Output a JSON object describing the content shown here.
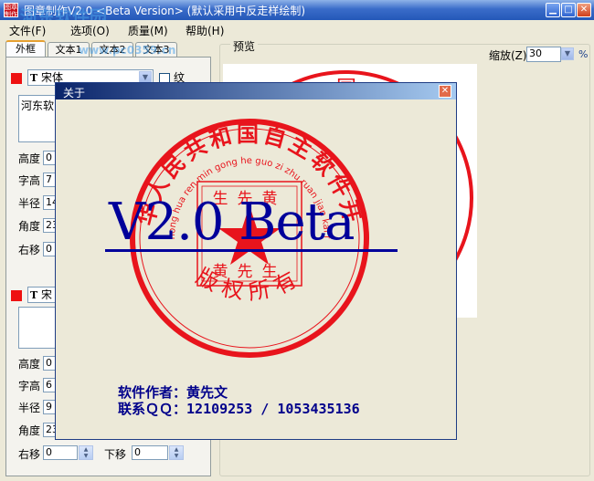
{
  "window": {
    "title": "图章制作V2.0 <Beta Version> (默认采用中反走样绘制)",
    "icon_text": "图章制作",
    "watermark": "河东软件园",
    "watermark_url": "www.pc0359.cn",
    "minimize_glyph": "▁",
    "maximize_glyph": "□",
    "close_glyph": "✕"
  },
  "menu": [
    {
      "label": "文件(F)"
    },
    {
      "label": "选项(O)"
    },
    {
      "label": "质量(M)"
    },
    {
      "label": "帮助(H)"
    }
  ],
  "tabs": [
    {
      "label": "外框"
    },
    {
      "label": "文本1"
    },
    {
      "label": "文本2"
    },
    {
      "label": "文本3"
    }
  ],
  "text1": {
    "font": "宋体",
    "font_icon": "T",
    "checkbox_label": "纹",
    "content": "河东软",
    "fields": [
      {
        "label": "高度",
        "value": "0"
      },
      {
        "label": "字高",
        "value": "7"
      },
      {
        "label": "半径",
        "value": "14"
      },
      {
        "label": "角度",
        "value": "23"
      },
      {
        "label": "右移",
        "value": "0"
      }
    ]
  },
  "text2": {
    "font_icon": "T",
    "font": "宋",
    "content": "",
    "fields": [
      {
        "label": "高度",
        "value": "0"
      },
      {
        "label": "字高",
        "value": "6"
      },
      {
        "label": "半径",
        "value": "9"
      },
      {
        "label": "角度",
        "value": "23"
      },
      {
        "label": "右移",
        "value": "0"
      },
      {
        "label": "下移",
        "value": "0"
      }
    ]
  },
  "preview": {
    "label": "预览",
    "zoom_label": "缩放(Z)",
    "zoom_value": "30",
    "zoom_unit": "%"
  },
  "about": {
    "title": "关于",
    "close_glyph": "✕",
    "version": "V2.0 Beta",
    "author_label": "软件作者：",
    "author_name": "黄先文",
    "qq_label": "联系ＱＱ：",
    "qq_value": "12109253 / 1053435136",
    "seal": {
      "outer_text": "中华人民共和国自主软件开发",
      "pinyin_text": "zhong hua ren min gong he guo zi zhu ruan jian kai fa",
      "bottom_text": "版权所有",
      "square_top": "生先黄",
      "square_bottom": "黄先生",
      "color": "#e8141c"
    }
  },
  "preview_seal": {
    "partial_text": "国",
    "color": "#e8141c"
  },
  "colors": {
    "titlebar": "#2458b8",
    "seal_red": "#e8141c",
    "version_blue": "#00009a",
    "dialog_title": "#0a246a"
  }
}
